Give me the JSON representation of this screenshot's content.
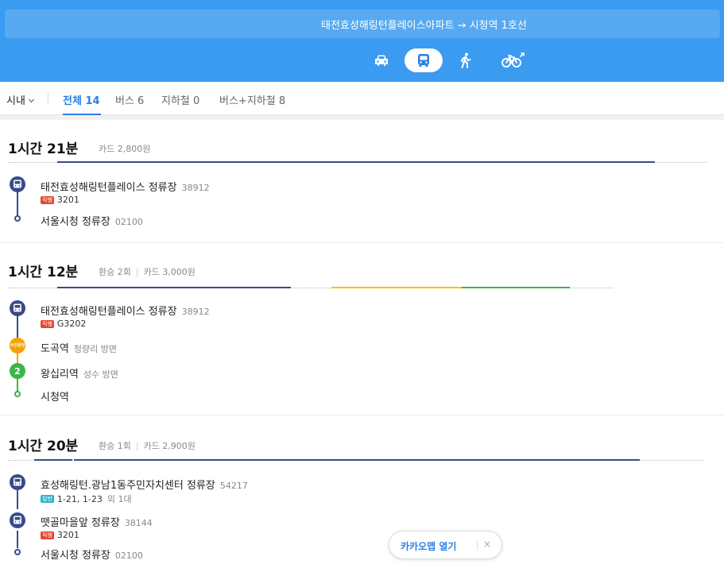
{
  "header": {
    "route": "태전효성해링턴플레이스아파트 → 시청역 1호선",
    "modes": [
      {
        "name": "car",
        "icon": "car-icon",
        "active": false
      },
      {
        "name": "bus",
        "icon": "bus-icon",
        "active": true
      },
      {
        "name": "walk",
        "icon": "walk-icon",
        "active": false
      },
      {
        "name": "bike",
        "icon": "bike-icon",
        "active": false
      }
    ],
    "active_color": "#2a7fe4",
    "bar_color": "#3a9bf0"
  },
  "tabs": {
    "region": "시내",
    "items": [
      {
        "label": "전체 14",
        "active": true
      },
      {
        "label": "버스 6",
        "active": false
      },
      {
        "label": "지하철 0",
        "active": false
      },
      {
        "label": "버스+지하철 8",
        "active": false
      }
    ]
  },
  "routes": [
    {
      "time": "1시간 21분",
      "meta": [
        "카드 2,800원"
      ],
      "stops": [
        {
          "icon": "bus-icon",
          "name": "태전효성해링턴플레이스 정류장",
          "sub": "38912",
          "line_badge": "직행",
          "line": "3201",
          "line_extra": ""
        },
        {
          "icon": "end-dot",
          "name": "서울시청 정류장",
          "sub": "02100"
        }
      ]
    },
    {
      "time": "1시간 12분",
      "meta": [
        "환승 2회",
        "카드 3,000원"
      ],
      "stops": [
        {
          "icon": "bus-icon",
          "name": "태전효성해링턴플레이스 정류장",
          "sub": "38912",
          "line_badge": "직행",
          "line": "G3202",
          "line_extra": ""
        },
        {
          "icon": "subway-suin-icon",
          "icon_text": "수인분당",
          "name": "도곡역",
          "sub": "청량리 방면"
        },
        {
          "icon": "subway-line2-icon",
          "icon_text": "2",
          "name": "왕십리역",
          "sub": "성수 방면"
        },
        {
          "icon": "end-dot",
          "name": "시청역",
          "sub": ""
        }
      ]
    },
    {
      "time": "1시간 20분",
      "meta": [
        "환승 1회",
        "카드 2,900원"
      ],
      "stops": [
        {
          "icon": "bus-icon",
          "name": "효성해링턴.광남1동주민자치센터 정류장",
          "sub": "54217",
          "line_badge": "일반",
          "line": "1-21, 1-23",
          "line_extra": "외 1대"
        },
        {
          "icon": "bus-icon",
          "name": "뗏골마을앞 정류장",
          "sub": "38144",
          "line_badge": "직행",
          "line": "3201",
          "line_extra": ""
        },
        {
          "icon": "end-dot",
          "name": "서울시청 정류장",
          "sub": "02100"
        }
      ]
    }
  ],
  "colors": {
    "bus_navy": "#394a8c",
    "express_red": "#e8452c",
    "regular_teal": "#2ab3c9",
    "suin_yellow": "#f5a200",
    "line2_green": "#3cb44a"
  },
  "footer": {
    "open_label": "카카오맵 열기",
    "close_label": "×"
  }
}
